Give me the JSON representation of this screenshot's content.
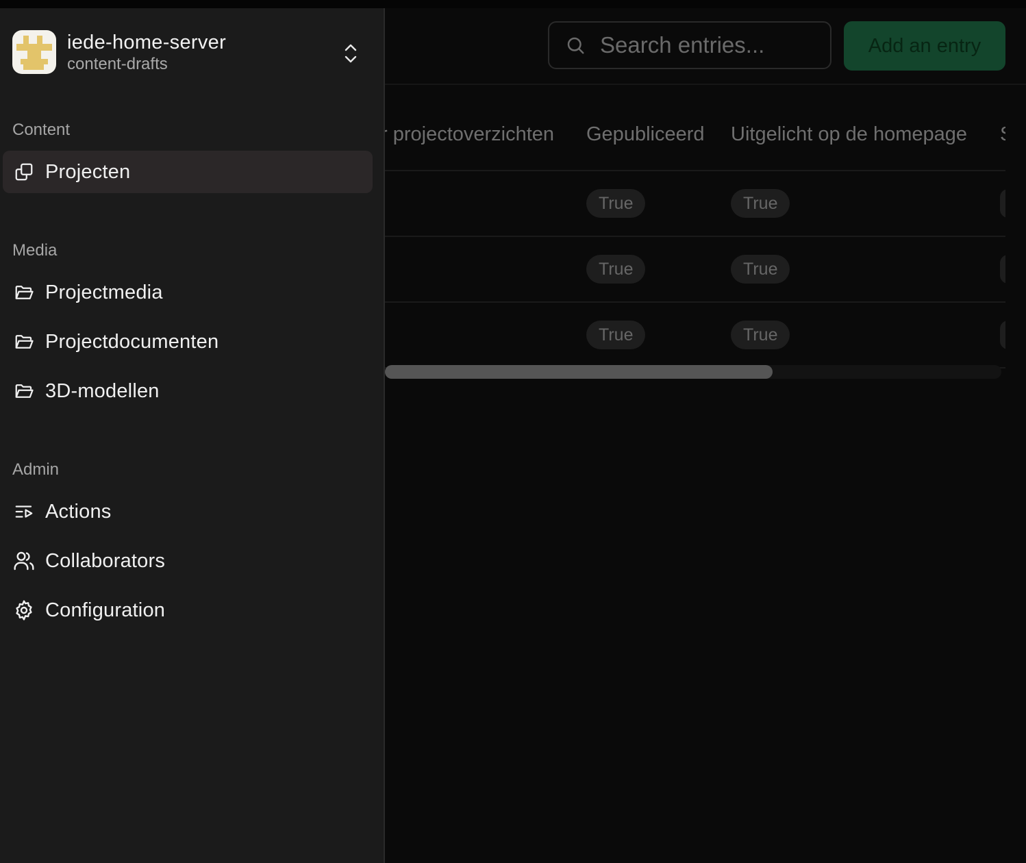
{
  "workspace": {
    "name": "iede-home-server",
    "branch": "content-drafts"
  },
  "sidebar": {
    "sections": [
      {
        "title": "Content",
        "items": [
          {
            "label": "Projecten",
            "icon": "copy-icon",
            "active": true
          }
        ]
      },
      {
        "title": "Media",
        "items": [
          {
            "label": "Projectmedia",
            "icon": "folder-icon"
          },
          {
            "label": "Projectdocumenten",
            "icon": "folder-icon"
          },
          {
            "label": "3D-modellen",
            "icon": "folder-icon"
          }
        ]
      },
      {
        "title": "Admin",
        "items": [
          {
            "label": "Actions",
            "icon": "actions-icon"
          },
          {
            "label": "Collaborators",
            "icon": "users-icon"
          },
          {
            "label": "Configuration",
            "icon": "gear-icon"
          }
        ]
      }
    ]
  },
  "toolbar": {
    "search_placeholder": "Search entries...",
    "add_label": "Add an entry"
  },
  "table": {
    "columns": [
      "r projectoverzichten",
      "Gepubliceerd",
      "Uitgelicht op de homepage",
      "S"
    ],
    "rows": [
      {
        "gepubliceerd": "True",
        "uitgelicht": "True"
      },
      {
        "gepubliceerd": "True",
        "uitgelicht": "True"
      },
      {
        "gepubliceerd": "True",
        "uitgelicht": "True"
      }
    ]
  },
  "colors": {
    "accent": "#1a9f5c",
    "sidebar_bg": "#1b1b1b",
    "active_item_bg": "#2b2728",
    "logo_mark": "#e3c46a"
  }
}
